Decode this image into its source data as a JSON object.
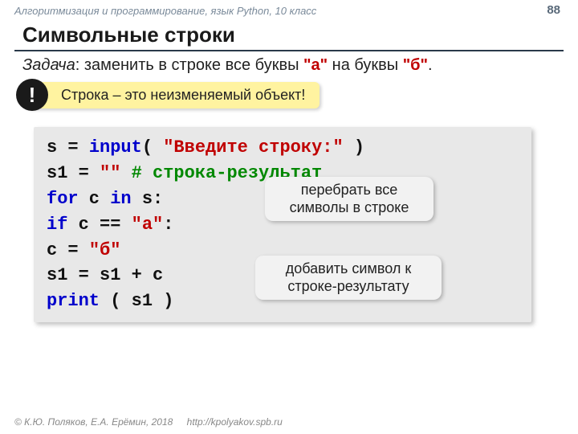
{
  "header": {
    "course": "Алгоритмизация и программирование, язык Python, 10 класс",
    "page": "88"
  },
  "title": "Символьные строки",
  "task": {
    "label": "Задача",
    "text": ": заменить в строке все буквы ",
    "a": "\"а\"",
    "mid": " на буквы ",
    "b": "\"б\"",
    "end": "."
  },
  "alert": {
    "badge": "!",
    "text": "Строка – это неизменяемый объект!"
  },
  "code": {
    "l1a": "s = ",
    "l1kw": "input",
    "l1b": "( ",
    "l1str": "\"Введите строку:\"",
    "l1c": " )",
    "l2a": "s1 = ",
    "l2str": "\"\"",
    "l2sp": "   ",
    "l2cmt": "# строка-результат",
    "l3kw1": "for",
    "l3a": " c ",
    "l3kw2": "in",
    "l3b": " s:",
    "l4sp": "  ",
    "l4kw": "if",
    "l4a": " c == ",
    "l4str": "\"а\"",
    "l4b": ":",
    "l5sp": "    c = ",
    "l5str": "\"б\"",
    "l6": "  s1 = s1 + c",
    "l7kw": "print",
    "l7a": " ( s1 )"
  },
  "callouts": {
    "c1": "перебрать все символы в строке",
    "c2": "добавить символ к строке-результату"
  },
  "footer": {
    "copyright": "© К.Ю. Поляков, Е.А. Ерёмин, 2018",
    "url": "http://kpolyakov.spb.ru"
  }
}
